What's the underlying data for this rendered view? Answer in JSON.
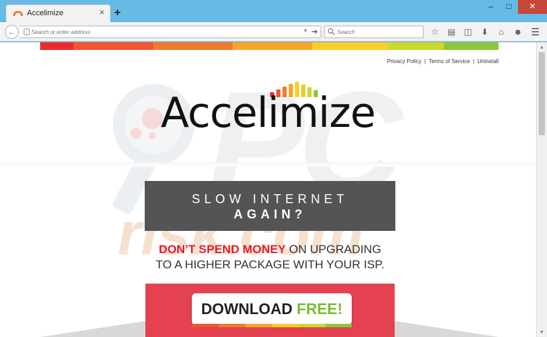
{
  "browser": {
    "tab_title": "Accelimize",
    "tab_close": "×",
    "new_tab": "+",
    "url_placeholder": "Search or enter address",
    "search_placeholder": "Search",
    "win_min": "–",
    "win_max": "□",
    "win_close": "✕"
  },
  "page": {
    "rainbow_colors": [
      "#ee2a2e",
      "#f2552f",
      "#f07a2c",
      "#f7a52a",
      "#fbcd2a",
      "#c9d92e",
      "#8cc63e"
    ],
    "links": [
      "Privacy Policy",
      "Terms of Service",
      "Uninstall"
    ],
    "separator": "|",
    "logo": "Accelimize",
    "watermark_main": "PC",
    "watermark_sub": "risk.com",
    "banner_line1": "SLOW INTERNET",
    "banner_line2": "AGAIN?",
    "msg_red": "DON’T SPEND MONEY",
    "msg_rest1": " ON UPGRADING",
    "msg_line2": "TO A HIGHER PACKAGE WITH YOUR ISP.",
    "button_text": "DOWNLOAD",
    "button_free": "FREE!",
    "accent_red": "#e44151",
    "accent_green": "#7dba2f"
  }
}
